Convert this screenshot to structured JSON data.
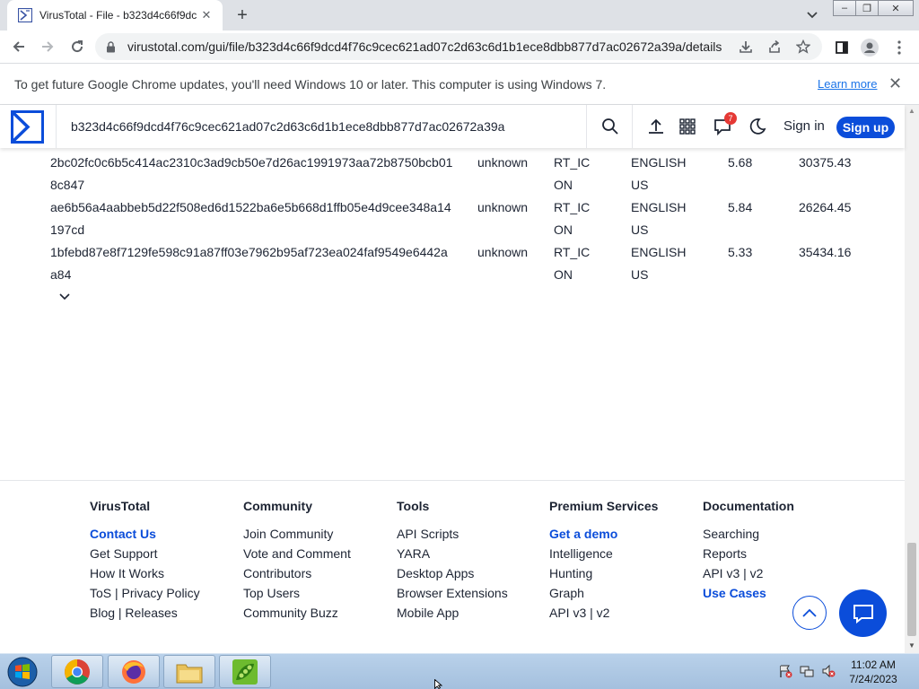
{
  "browser": {
    "tab_title": "VirusTotal - File - b323d4c66f9dc",
    "url": "virustotal.com/gui/file/b323d4c66f9dcd4f76c9cec621ad07c2d63c6d1b1ece8dbb877d7ac02672a39a/details",
    "infobar_text": "To get future Google Chrome updates, you'll need Windows 10 or later. This computer is using Windows 7.",
    "infobar_link": "Learn more"
  },
  "header": {
    "search_value": "b323d4c66f9dcd4f76c9cec621ad07c2d63c6d1b1ece8dbb877d7ac02672a39a",
    "notification_count": "7",
    "signin_label": "Sign in",
    "signup_label": "Sign up"
  },
  "resources": [
    {
      "sha256": "2bc02fc0c6b5c414ac2310c3ad9cb50e7d26ac1991973aa72b8750bcb018c847",
      "type": "unknown",
      "resource": "RT_ICON",
      "language": "ENGLISH US",
      "entropy": "5.68",
      "chi2": "30375.43"
    },
    {
      "sha256": "ae6b56a4aabbeb5d22f508ed6d1522ba6e5b668d1ffb05e4d9cee348a14197cd",
      "type": "unknown",
      "resource": "RT_ICON",
      "language": "ENGLISH US",
      "entropy": "5.84",
      "chi2": "26264.45"
    },
    {
      "sha256": "1bfebd87e8f7129fe598c91a87ff03e7962b95af723ea024faf9549e6442aa84",
      "type": "unknown",
      "resource": "RT_ICON",
      "language": "ENGLISH US",
      "entropy": "5.33",
      "chi2": "35434.16"
    }
  ],
  "footer": {
    "columns": [
      {
        "heading": "VirusTotal",
        "links": [
          "Contact Us",
          "Get Support",
          "How It Works",
          "ToS | Privacy Policy",
          "Blog | Releases"
        ]
      },
      {
        "heading": "Community",
        "links": [
          "Join Community",
          "Vote and Comment",
          "Contributors",
          "Top Users",
          "Community Buzz"
        ]
      },
      {
        "heading": "Tools",
        "links": [
          "API Scripts",
          "YARA",
          "Desktop Apps",
          "Browser Extensions",
          "Mobile App"
        ]
      },
      {
        "heading": "Premium Services",
        "links": [
          "Get a demo",
          "Intelligence",
          "Hunting",
          "Graph",
          "API v3 | v2"
        ]
      },
      {
        "heading": "Documentation",
        "links": [
          "Searching",
          "Reports",
          "API v3 | v2",
          "Use Cases"
        ]
      }
    ]
  },
  "taskbar": {
    "time": "11:02 AM",
    "date": "7/24/2023"
  },
  "colors": {
    "brand_blue": "#0b4dda",
    "text": "#1d2433",
    "badge_red": "#e53935"
  }
}
